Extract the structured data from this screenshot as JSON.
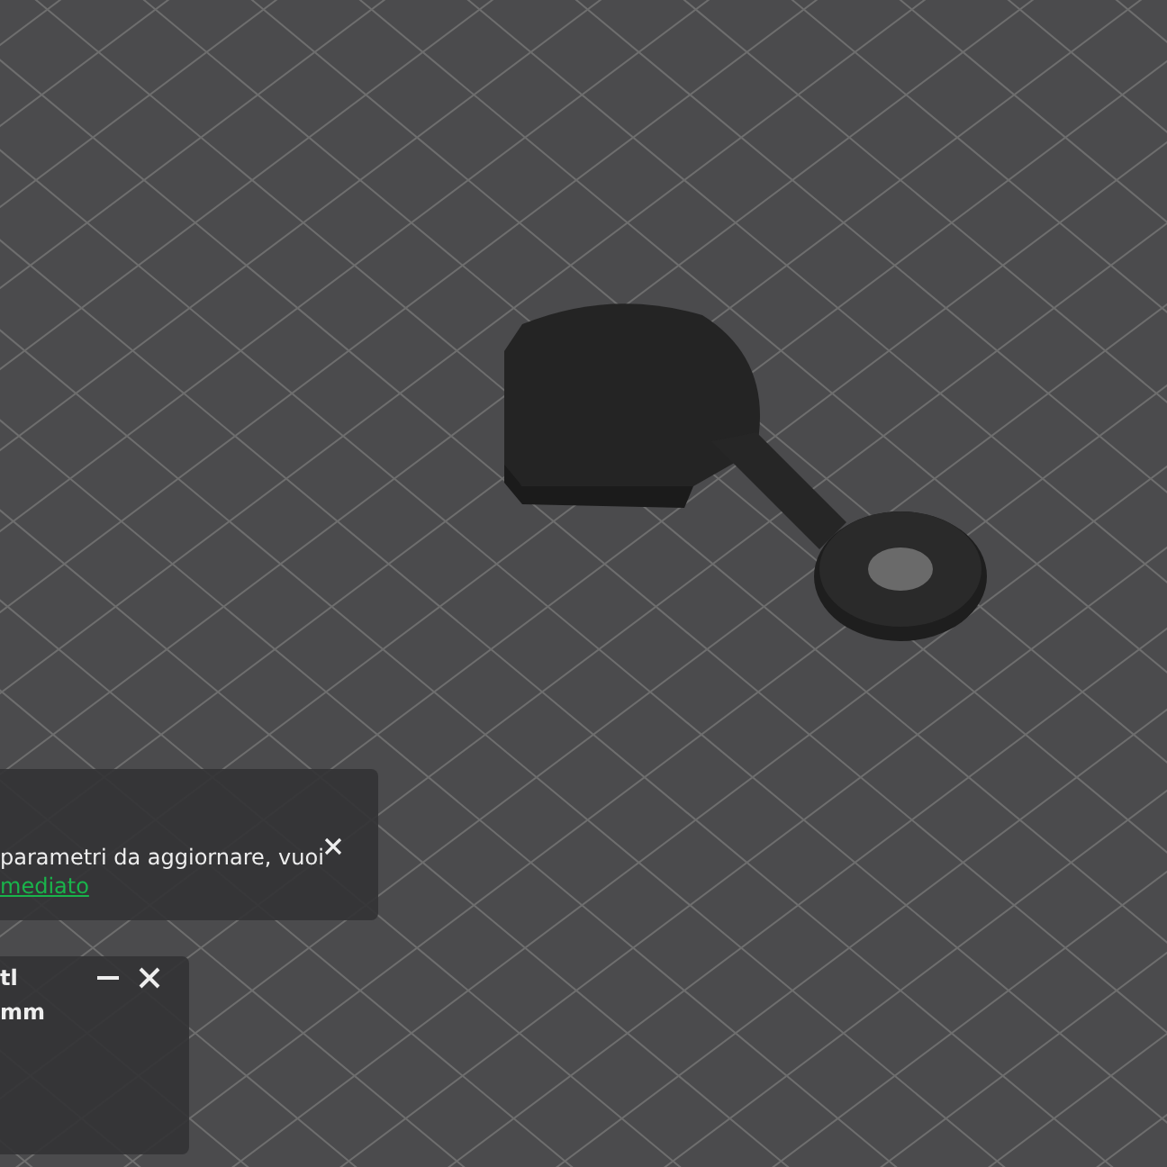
{
  "notifications": [
    {
      "kind": "update",
      "text": "parametri da aggiornare, vuoi",
      "link": "mediato"
    },
    {
      "kind": "info",
      "title": "tl",
      "detail": "mm"
    }
  ]
}
